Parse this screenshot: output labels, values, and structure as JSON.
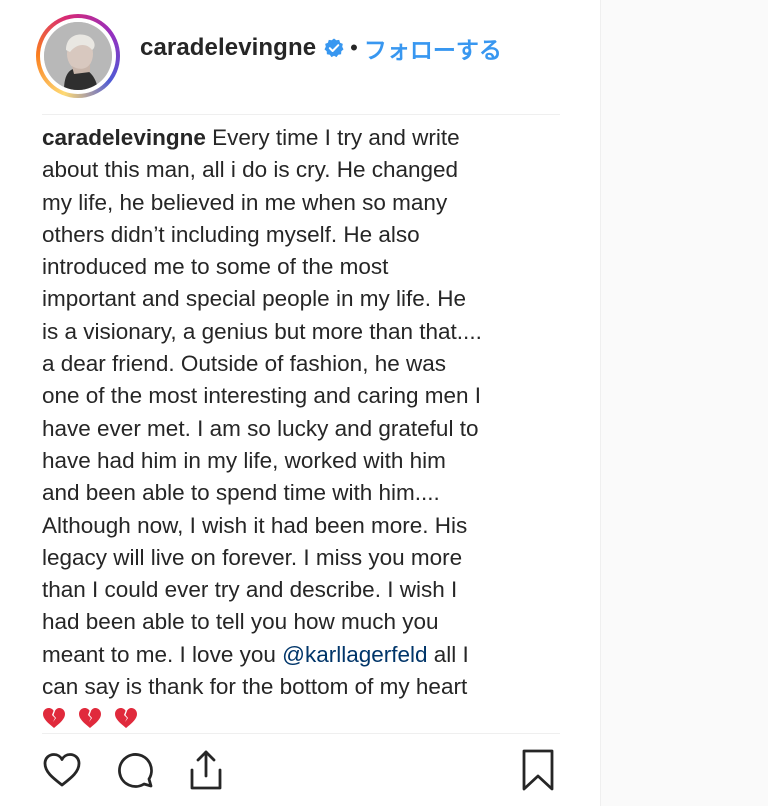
{
  "post": {
    "username": "caradelevingne",
    "verified": true,
    "separator": "•",
    "follow_label": "フォローする"
  },
  "caption": {
    "username": "caradelevingne",
    "lines": [
      "Every time I try and write",
      "about this man, all i do is cry. He changed",
      "my life, he believed in me when so many",
      "others didn’t including myself. He also",
      "introduced me to some of the most",
      "important and special people in my life. He",
      "is a visionary, a genius but more than that....",
      "a dear friend. Outside of fashion, he was",
      "one of the most interesting and caring men I",
      "have ever met. I am so lucky and grateful to",
      "have had him in my life, worked with him",
      "and been able to spend time with him....",
      "Although now, I wish it had been more. His",
      "legacy will live on forever. I miss you more",
      "than I could ever try and describe. I wish I",
      "had been able to tell you how much you",
      "meant to me. I love you",
      "can say is thank for the bottom of my heart"
    ],
    "mention": "@karllagerfeld",
    "after_mention": " all I",
    "emojis": [
      "broken-heart",
      "broken-heart",
      "broken-heart"
    ]
  },
  "actions": {
    "like": "heart-icon",
    "comment": "comment-icon",
    "share": "share-icon",
    "save": "bookmark-icon"
  },
  "colors": {
    "text": "#262626",
    "follow_blue": "#3897f0",
    "mention": "#003569",
    "verified": "#3897f0",
    "emoji_red": "#e02a3c"
  }
}
